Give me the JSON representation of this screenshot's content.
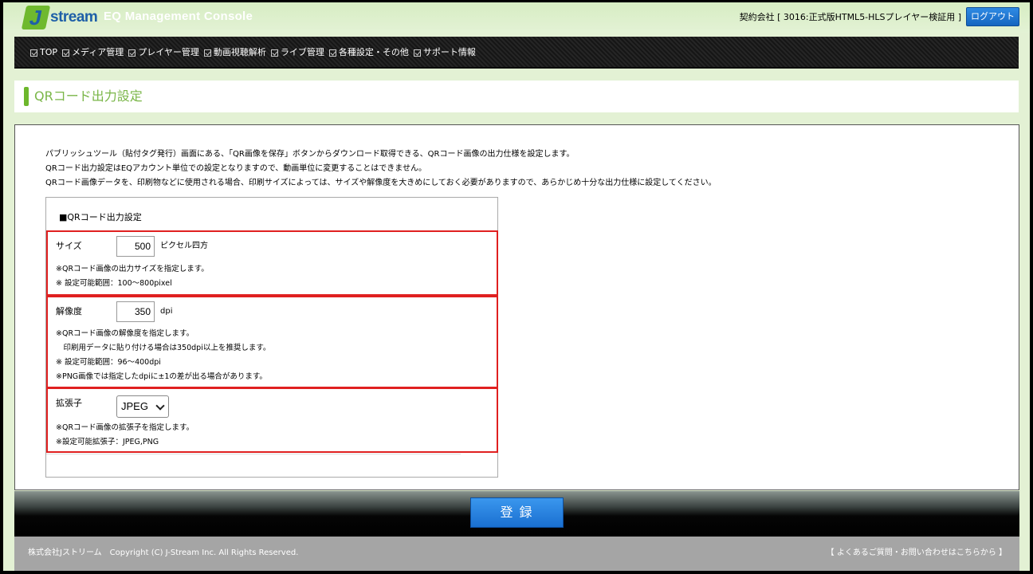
{
  "header": {
    "logo_letter": "J",
    "logo_text": "stream",
    "app_title": "EQ Management Console",
    "contract_label": "契約会社 [ 3016:正式版HTML5-HLSプレイヤー検証用 ]",
    "logout_label": "ログアウト"
  },
  "nav": {
    "items": [
      {
        "label": "TOP"
      },
      {
        "label": "メディア管理"
      },
      {
        "label": "プレイヤー管理"
      },
      {
        "label": "動画視聴解析"
      },
      {
        "label": "ライブ管理"
      },
      {
        "label": "各種設定・その他"
      },
      {
        "label": "サポート情報"
      }
    ]
  },
  "page": {
    "title": "QRコード出力設定"
  },
  "description": {
    "line1": "パブリッシュツール（貼付タグ発行）画面にある、「QR画像を保存」ボタンからダウンロード取得できる、QRコード画像の出力仕様を設定します。",
    "line2": "QRコード出力設定はEQアカウント単位での設定となりますので、動画単位に変更することはできません。",
    "line3": "QRコード画像データを、印刷物などに使用される場合、印刷サイズによっては、サイズや解像度を大きめにしておく必要がありますので、あらかじめ十分な出力仕様に設定してください。"
  },
  "settings": {
    "box_title": "■QRコード出力設定",
    "size": {
      "label": "サイズ",
      "value": "500",
      "unit": "ピクセル四方",
      "note1": "※QRコード画像の出力サイズを指定します。",
      "note2": "※ 設定可能範囲：100～800pixel"
    },
    "dpi": {
      "label": "解像度",
      "value": "350",
      "unit": "dpi",
      "note1": "※QRコード画像の解像度を指定します。",
      "note2": "　印刷用データに貼り付ける場合は350dpi以上を推奨します。",
      "note3": "※ 設定可能範囲：96～400dpi",
      "note4": "※PNG画像では指定したdpiに±1の差が出る場合があります。"
    },
    "extension": {
      "label": "拡張子",
      "selected": "JPEG",
      "note1": "※QRコード画像の拡張子を指定します。",
      "note2": "※設定可能拡張子：JPEG,PNG"
    }
  },
  "actions": {
    "register_label": "登録"
  },
  "footer": {
    "copyright": "株式会社Jストリーム　Copyright (C) J-Stream Inc. All Rights Reserved.",
    "faq_link": "【 よくあるご質問・お問い合わせはこちらから 】"
  },
  "colors": {
    "accent_green": "#6db72c",
    "button_blue": "#1a6fd0",
    "highlight_red": "#e02020"
  }
}
